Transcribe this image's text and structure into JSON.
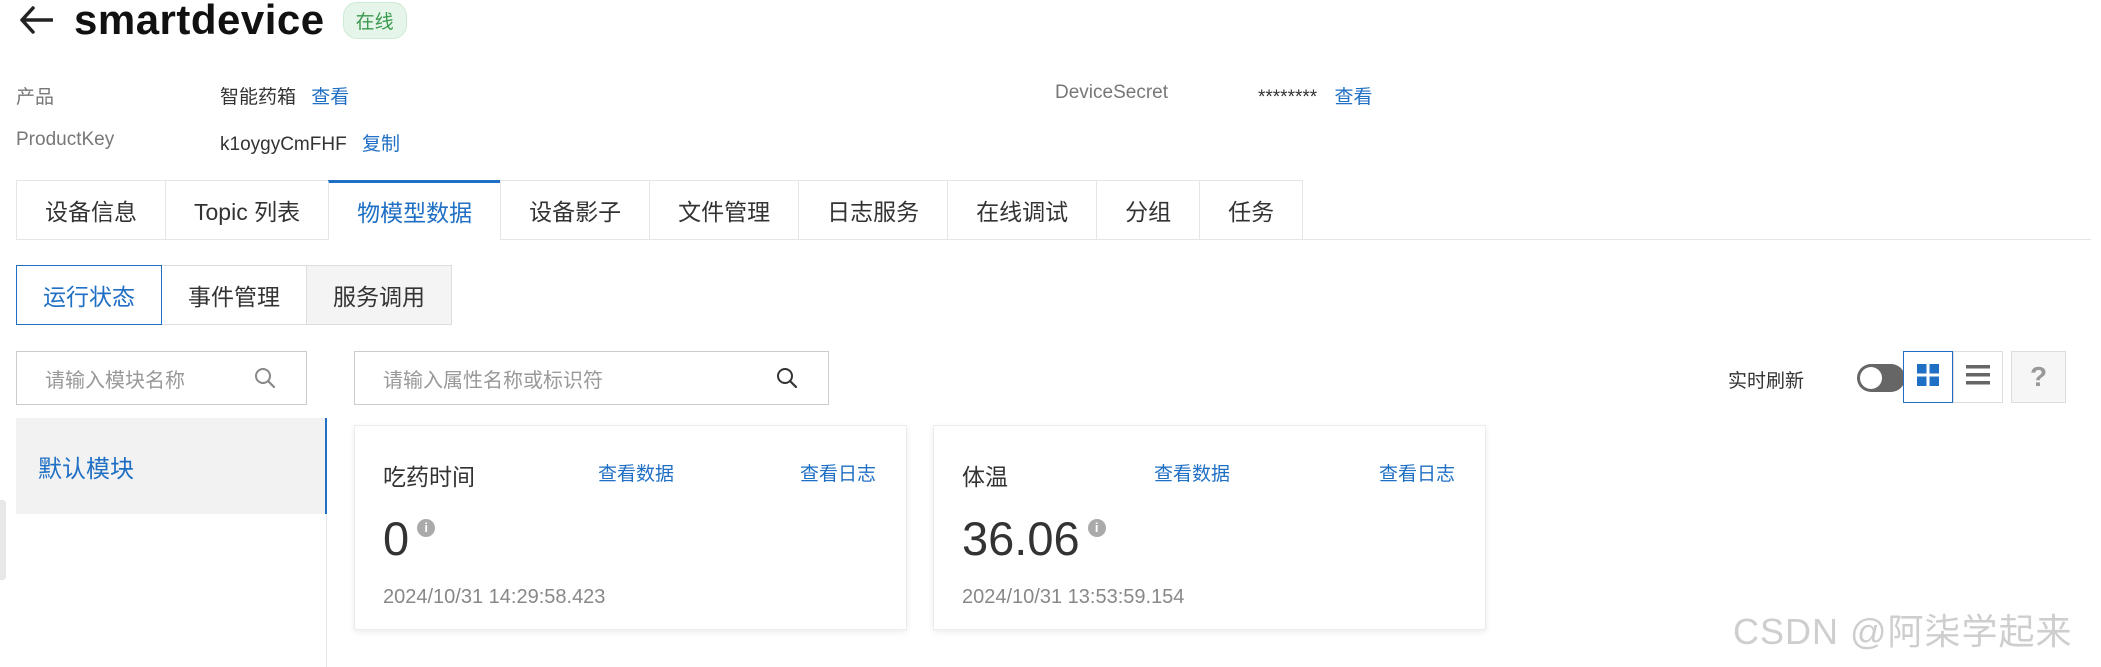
{
  "header": {
    "title": "smartdevice",
    "status": "在线"
  },
  "meta": {
    "product_label": "产品",
    "product_value": "智能药箱",
    "product_link": "查看",
    "productkey_label": "ProductKey",
    "productkey_value": "k1oygyCmFHF",
    "productkey_link": "复制",
    "secret_label": "DeviceSecret",
    "secret_value": "********",
    "secret_link": "查看"
  },
  "tabs": [
    "设备信息",
    "Topic 列表",
    "物模型数据",
    "设备影子",
    "文件管理",
    "日志服务",
    "在线调试",
    "分组",
    "任务"
  ],
  "active_tab": "物模型数据",
  "subtabs": [
    "运行状态",
    "事件管理",
    "服务调用"
  ],
  "active_subtab": "运行状态",
  "module_search": {
    "placeholder": "请输入模块名称"
  },
  "property_search": {
    "placeholder": "请输入属性名称或标识符"
  },
  "modules": [
    {
      "label": "默认模块",
      "selected": true
    }
  ],
  "realtime_refresh": {
    "label": "实时刷新",
    "enabled": false
  },
  "view_modes": [
    {
      "name": "grid-view",
      "active": true
    },
    {
      "name": "list-view",
      "active": false
    }
  ],
  "help": {
    "label": "?"
  },
  "cards": [
    {
      "title": "吃药时间",
      "view_data": "查看数据",
      "view_log": "查看日志",
      "value": "0",
      "timestamp": "2024/10/31 14:29:58.423"
    },
    {
      "title": "体温",
      "view_data": "查看数据",
      "view_log": "查看日志",
      "value": "36.06",
      "timestamp": "2024/10/31 13:53:59.154"
    }
  ],
  "watermark": "CSDN @阿柒学起来",
  "colors": {
    "accent": "#1f6fc4",
    "online_badge_bg": "#e6f5e9",
    "online_badge_text": "#3a9a4e"
  }
}
